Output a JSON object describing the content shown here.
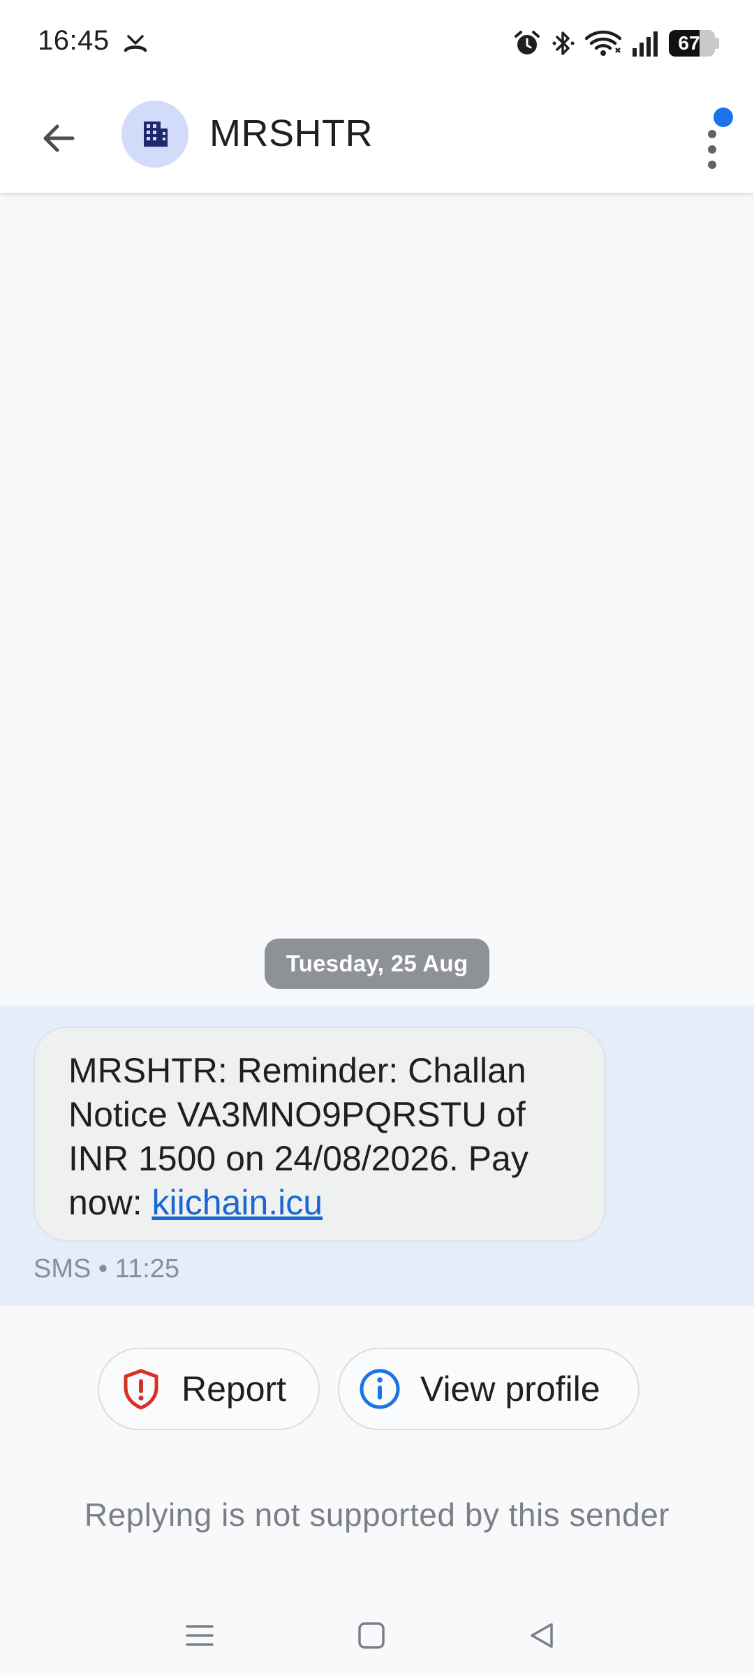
{
  "status_bar": {
    "time": "16:45",
    "battery_level": "67",
    "battery_fraction": 0.67,
    "left_icons": [
      "missed-call-icon"
    ],
    "right_icons": [
      "alarm-icon",
      "bluetooth-icon",
      "wifi-icon",
      "cellular-signal-icon",
      "battery-icon"
    ]
  },
  "header": {
    "contact_name": "MRSHTR",
    "avatar_icon": "business-building-icon",
    "back_icon": "arrow-back-icon",
    "menu_icon": "more-vert-icon",
    "menu_badge_color": "#1a73e8"
  },
  "conversation": {
    "date_label": "Tuesday, 25 Aug",
    "message": {
      "text": "MRSHTR: Reminder: Challan Notice VA3MNO9PQRSTU of INR 1500 on 24/08/2026. Pay now: ",
      "link_text": "kiichain.icu",
      "meta": "SMS • 11:25"
    }
  },
  "actions": {
    "report_label": "Report",
    "report_icon": "shield-alert-icon",
    "view_profile_label": "View profile",
    "view_profile_icon": "info-icon"
  },
  "footer": {
    "reply_note": "Replying is not supported by this sender"
  },
  "nav_bar": {
    "icons": [
      "menu-icon",
      "home-icon",
      "back-triangle-icon"
    ]
  },
  "colors": {
    "accent": "#1a73e8",
    "highlight_band": "#e5edfc",
    "date_chip": "#8e9196",
    "report_icon": "#d93025",
    "avatar_bg": "#d3dbfb",
    "avatar_icon": "#1f2a6e"
  }
}
